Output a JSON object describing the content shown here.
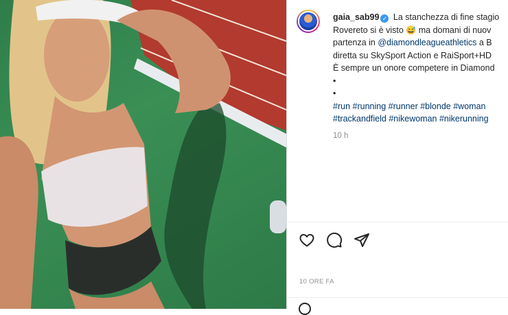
{
  "post": {
    "username": "gaia_sab99",
    "caption_lines": [
      "La stanchezza di fine stagio",
      "Rovereto si è visto",
      "ma domani di nuov",
      "partenza in",
      "@diamondleagueathletics",
      "a B",
      "diretta su SkySport Action e RaiSport+HD",
      "È sempre un onore competere in Diamond",
      "•",
      "•"
    ],
    "emoji": "😅",
    "hashtag_lines": [
      [
        "#run",
        "#running",
        "#runner",
        "#blonde",
        "#woman"
      ],
      [
        "#trackandfield",
        "#nikewoman",
        "#nikerunning"
      ]
    ],
    "comment_time": "10 h",
    "date": "10 ORE FA"
  },
  "icons": {
    "like": "heart-icon",
    "comment": "comment-icon",
    "share": "share-icon",
    "verified": "verified-badge-icon"
  },
  "colors": {
    "link": "#00376b",
    "verified": "#3897f0",
    "muted": "#8e8e8e",
    "track": "#b23a2e",
    "grass": "#2f7d4a"
  }
}
